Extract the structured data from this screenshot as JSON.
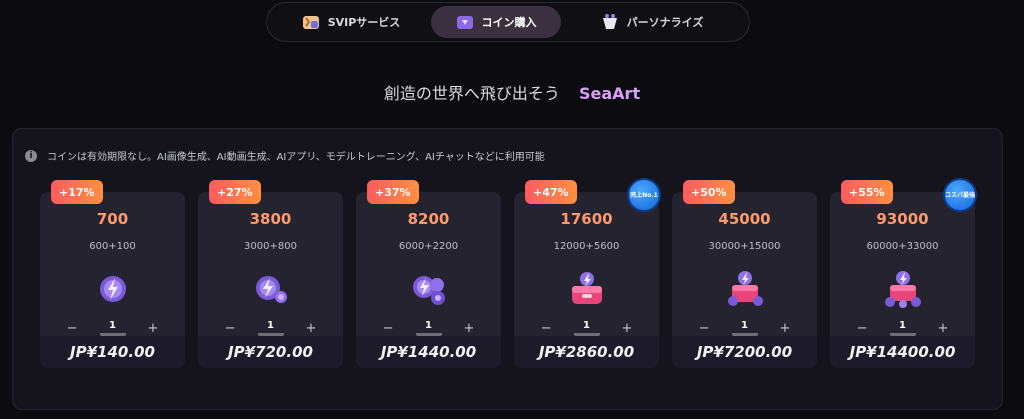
{
  "tabs": [
    {
      "label": "SVIPサービス",
      "icon": "svip-icon",
      "active": false
    },
    {
      "label": "コイン購入",
      "icon": "coin-purchase-icon",
      "active": true
    },
    {
      "label": "パーソナライズ",
      "icon": "personalize-icon",
      "active": false
    }
  ],
  "headline": {
    "text": "創造の世界へ飛び出そう",
    "brand": "SeaArt"
  },
  "notice": "コインは有効期限なし。AI画像生成、AI動画生成、AIアプリ、モデルトレーニング、AIチャットなどに利用可能",
  "cards": [
    {
      "bonus": "+17%",
      "coins": "700",
      "breakdown": "600+100",
      "qty": "1",
      "price": "JP¥140.00",
      "ribbon": ""
    },
    {
      "bonus": "+27%",
      "coins": "3800",
      "breakdown": "3000+800",
      "qty": "1",
      "price": "JP¥720.00",
      "ribbon": ""
    },
    {
      "bonus": "+37%",
      "coins": "8200",
      "breakdown": "6000+2200",
      "qty": "1",
      "price": "JP¥1440.00",
      "ribbon": ""
    },
    {
      "bonus": "+47%",
      "coins": "17600",
      "breakdown": "12000+5600",
      "qty": "1",
      "price": "JP¥2860.00",
      "ribbon": "売上No.1"
    },
    {
      "bonus": "+50%",
      "coins": "45000",
      "breakdown": "30000+15000",
      "qty": "1",
      "price": "JP¥7200.00",
      "ribbon": ""
    },
    {
      "bonus": "+55%",
      "coins": "93000",
      "breakdown": "60000+33000",
      "qty": "1",
      "price": "JP¥14400.00",
      "ribbon": "コスパ最強"
    }
  ],
  "stepper": {
    "minus": "−",
    "plus": "+"
  },
  "colors": {
    "accent": "#d7a0f5",
    "bonus_start": "#ff5a5f",
    "bonus_end": "#ff9040",
    "coin_value": "#ff9a6a",
    "badge_blue": "#1565d8"
  }
}
